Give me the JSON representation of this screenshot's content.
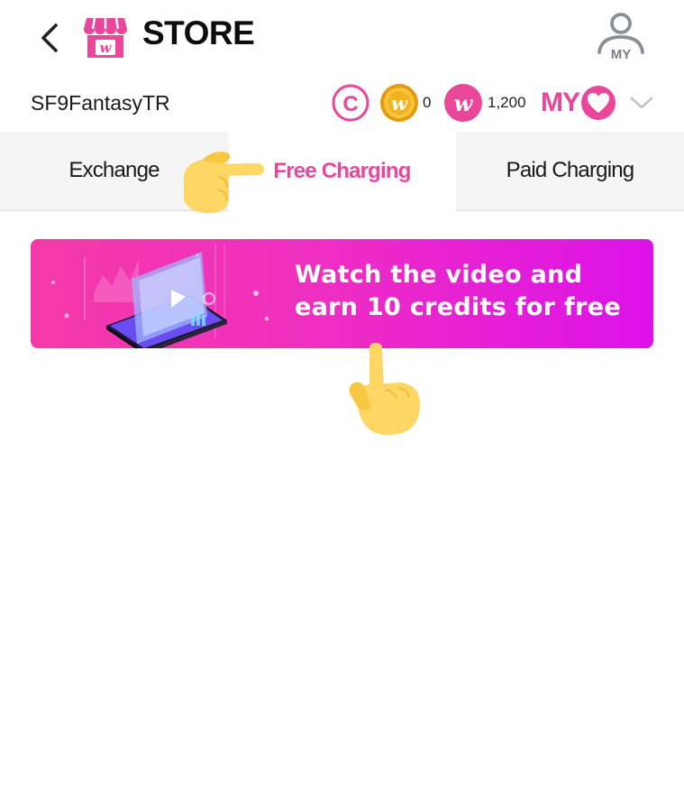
{
  "header": {
    "title": "STORE",
    "back_icon": "chevron-left-icon",
    "logo_icon": "store-icon",
    "logo_letter": "w",
    "profile_label": "MY",
    "profile_icon": "user-icon"
  },
  "account": {
    "username": "SF9FantasyTR",
    "refresh_letter": "C",
    "coin_letter": "w",
    "coin_count": "0",
    "w_letter": "w",
    "w_count": "1,200",
    "my_label": "MY",
    "heart_icon": "heart-icon",
    "dropdown_icon": "chevron-down-icon"
  },
  "tabs": [
    {
      "label": "Exchange",
      "active": false
    },
    {
      "label": "Free Charging",
      "active": true
    },
    {
      "label": "Paid Charging",
      "active": false
    }
  ],
  "banner": {
    "line1": "Watch the video and",
    "line2": "earn 10 credits for free",
    "art_icon": "phone-video-play-icon"
  },
  "pointers": {
    "tab_pointer_icon": "hand-pointing-right-icon",
    "banner_pointer_icon": "hand-pointing-up-icon"
  },
  "colors": {
    "accent": "#e8479a",
    "banner_start": "#f43aa8",
    "banner_end": "#dc12ea",
    "tab_bg": "#f5f5f5"
  }
}
